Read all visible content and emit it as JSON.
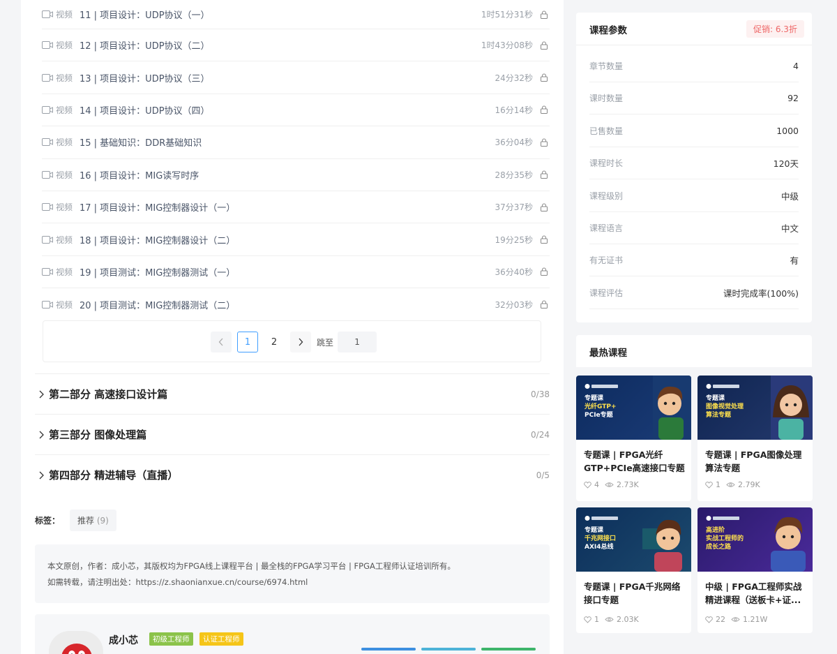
{
  "lessons": [
    {
      "type": "视频",
      "title": "11 | 项目设计：UDP协议（一）",
      "duration": "1时51分31秒"
    },
    {
      "type": "视频",
      "title": "12 | 项目设计：UDP协议（二）",
      "duration": "1时43分08秒"
    },
    {
      "type": "视频",
      "title": "13 | 项目设计：UDP协议（三）",
      "duration": "24分32秒"
    },
    {
      "type": "视频",
      "title": "14 | 项目设计：UDP协议（四）",
      "duration": "16分14秒"
    },
    {
      "type": "视频",
      "title": "15 | 基础知识：DDR基础知识",
      "duration": "36分04秒"
    },
    {
      "type": "视频",
      "title": "16 | 项目设计：MIG读写时序",
      "duration": "28分35秒"
    },
    {
      "type": "视频",
      "title": "17 | 项目设计：MIG控制器设计（一）",
      "duration": "37分37秒"
    },
    {
      "type": "视频",
      "title": "18 | 项目设计：MIG控制器设计（二）",
      "duration": "19分25秒"
    },
    {
      "type": "视频",
      "title": "19 | 项目测试：MIG控制器测试（一）",
      "duration": "36分40秒"
    },
    {
      "type": "视频",
      "title": "20 | 项目测试：MIG控制器测试（二）",
      "duration": "32分03秒"
    }
  ],
  "pagination": {
    "pages": [
      "1",
      "2"
    ],
    "current": "1",
    "jump_label": "跳至",
    "jump_value": "1",
    "prev_icon": "chevron-left-icon",
    "next_icon": "chevron-right-icon"
  },
  "sections": [
    {
      "name": "第二部分 高速接口设计篇",
      "count": "0/38"
    },
    {
      "name": "第三部分 图像处理篇",
      "count": "0/24"
    },
    {
      "name": "第四部分 精进辅导（直播）",
      "count": "0/5"
    }
  ],
  "tags": {
    "label": "标签：",
    "items": [
      {
        "name": "推荐",
        "count": "(9)"
      }
    ]
  },
  "copyright": {
    "line1": "本文原创，作者：成小芯，其版权均为FPGA线上课程平台 | 最全栈的FPGA学习平台 | FPGA工程师认证培训所有。",
    "line2": "如需转载，请注明出处：https://z.shaonianxue.cn/course/6974.html"
  },
  "author": {
    "name": "成小芯",
    "badges": [
      "初级工程师",
      "认证工程师"
    ]
  },
  "params": {
    "title": "课程参数",
    "promo": "促销: 6.3折",
    "rows": [
      {
        "key": "章节数量",
        "value": "4"
      },
      {
        "key": "课时数量",
        "value": "92"
      },
      {
        "key": "已售数量",
        "value": "1000"
      },
      {
        "key": "课程时长",
        "value": "120天"
      },
      {
        "key": "课程级别",
        "value": "中级"
      },
      {
        "key": "课程语言",
        "value": "中文"
      },
      {
        "key": "有无证书",
        "value": "有"
      },
      {
        "key": "课程评估",
        "value": "课时完成率(100%)"
      }
    ]
  },
  "hot": {
    "title": "最热课程",
    "courses": [
      {
        "title": "专题课 | FPGA光纤GTP+PCIe高速接口专题",
        "likes": "4",
        "views": "2.73K",
        "img_line1": "专题课",
        "img_line2": "光纤GTP+",
        "img_line3": "PCIe专题"
      },
      {
        "title": "专题课 | FPGA图像处理算法专题",
        "likes": "1",
        "views": "2.79K",
        "img_line1": "专题课",
        "img_line2": "图像视觉处理",
        "img_line3": "算法专题"
      },
      {
        "title": "专题课 | FPGA千兆网络接口专题",
        "likes": "1",
        "views": "2.03K",
        "img_line1": "专题课",
        "img_line2": "千兆网接口",
        "img_line3": "AXI4总线"
      },
      {
        "title": "中级 | FPGA工程师实战精进课程（送板卡+证...",
        "likes": "22",
        "views": "1.21W",
        "img_line1": "高进阶",
        "img_line2": "实战工程师的",
        "img_line3": "成长之路"
      }
    ]
  },
  "colors": {
    "accent": "#409eff",
    "promo": "#e66666",
    "badge_green": "#8bc34a",
    "badge_yellow": "#f5c518"
  }
}
